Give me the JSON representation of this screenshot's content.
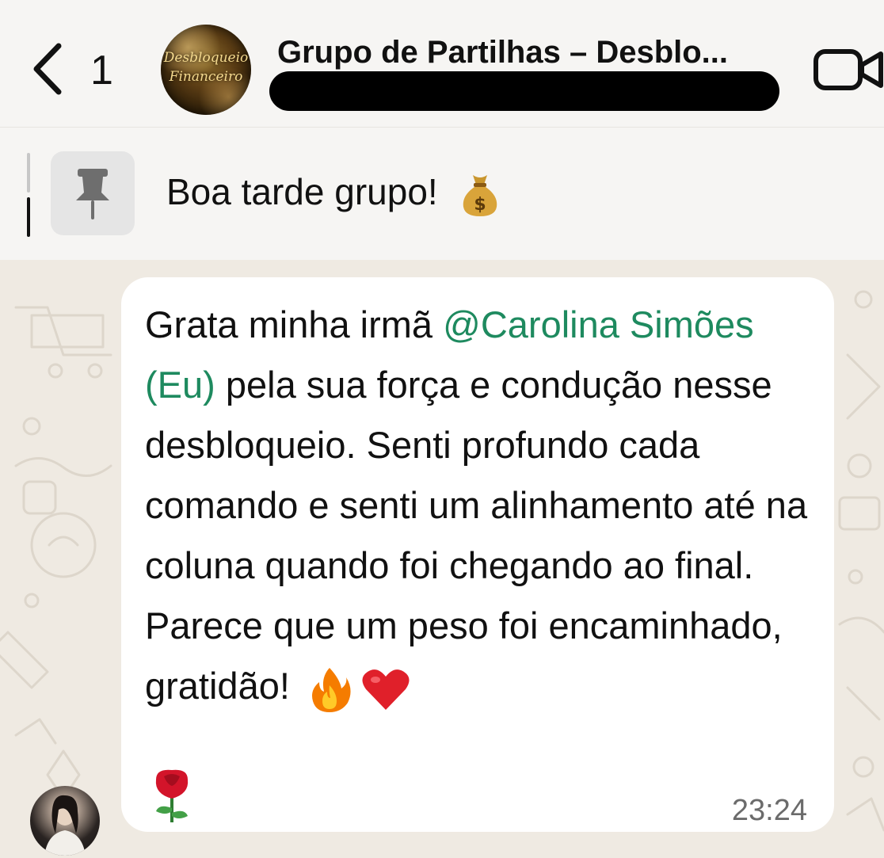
{
  "header": {
    "back_count": "1",
    "group_logo_text_line1": "Desbloqueio",
    "group_logo_text_line2": "Financeiro",
    "title": "Grupo de Partilhas – Desblo..."
  },
  "pinned": {
    "text": "Boa tarde grupo!"
  },
  "message": {
    "text_before": "Grata minha irmã ",
    "mention": "@Carolina Simões (Eu)",
    "text_after": " pela sua força e condução nesse desbloqueio. Senti profundo cada comando e senti um alinhamento até na coluna quando foi chegando ao final. Parece que um peso foi encaminhado, gratidão!",
    "time": "23:24"
  },
  "colors": {
    "mention": "#1e8a5f",
    "header_bg": "#f6f5f3",
    "chat_bg": "#efeae2"
  },
  "icons": [
    "chevron-left-icon",
    "video-call-icon",
    "pin-icon",
    "money-bag-emoji",
    "fire-emoji",
    "heart-emoji",
    "rose-emoji"
  ]
}
